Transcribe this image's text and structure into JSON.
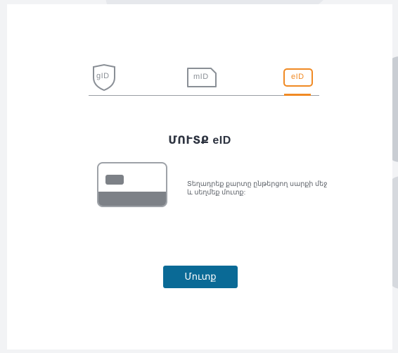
{
  "tabs": [
    {
      "id": "gid",
      "label": "gID",
      "active": false,
      "icon": "shield-icon"
    },
    {
      "id": "mid",
      "label": "mID",
      "active": false,
      "icon": "sim-card-icon"
    },
    {
      "id": "eid",
      "label": "eID",
      "active": true,
      "icon": "id-card-icon"
    }
  ],
  "colors": {
    "accent": "#f08a24",
    "primary_button": "#0a6a96",
    "icon_gray": "#8a8f96"
  },
  "main": {
    "title": "ՄՈՒՏՔ eID",
    "instruction": "Տեղադրեք քարտը ընթերցող սարքի մեջ և սեղմեք մուտք:",
    "login_label": "Մուտք",
    "illustration_icon": "id-card-reader-icon"
  }
}
